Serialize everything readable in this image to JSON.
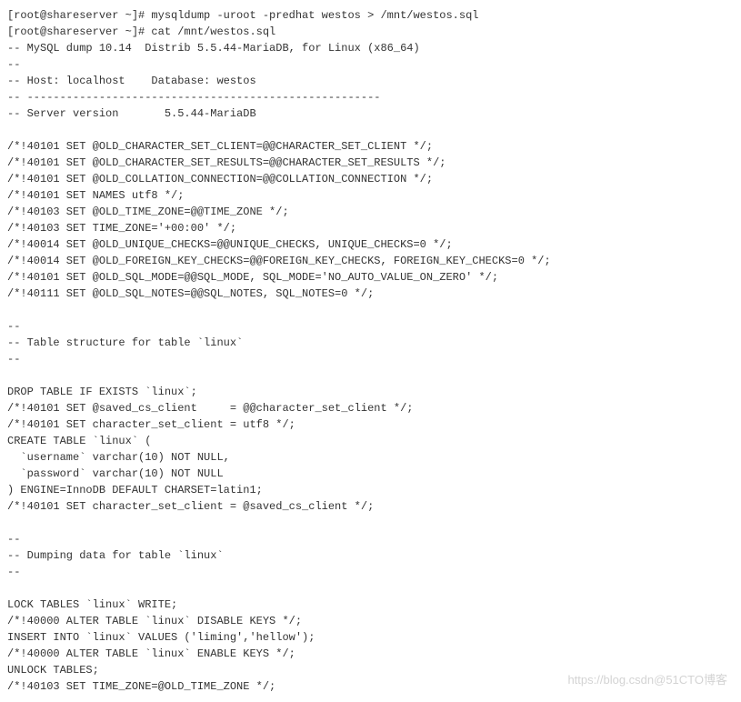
{
  "lines": [
    "[root@shareserver ~]# mysqldump -uroot -predhat westos > /mnt/westos.sql",
    "[root@shareserver ~]# cat /mnt/westos.sql",
    "-- MySQL dump 10.14  Distrib 5.5.44-MariaDB, for Linux (x86_64)",
    "--",
    "-- Host: localhost    Database: westos",
    "-- ------------------------------------------------------",
    "-- Server version       5.5.44-MariaDB",
    "",
    "/*!40101 SET @OLD_CHARACTER_SET_CLIENT=@@CHARACTER_SET_CLIENT */;",
    "/*!40101 SET @OLD_CHARACTER_SET_RESULTS=@@CHARACTER_SET_RESULTS */;",
    "/*!40101 SET @OLD_COLLATION_CONNECTION=@@COLLATION_CONNECTION */;",
    "/*!40101 SET NAMES utf8 */;",
    "/*!40103 SET @OLD_TIME_ZONE=@@TIME_ZONE */;",
    "/*!40103 SET TIME_ZONE='+00:00' */;",
    "/*!40014 SET @OLD_UNIQUE_CHECKS=@@UNIQUE_CHECKS, UNIQUE_CHECKS=0 */;",
    "/*!40014 SET @OLD_FOREIGN_KEY_CHECKS=@@FOREIGN_KEY_CHECKS, FOREIGN_KEY_CHECKS=0 */;",
    "/*!40101 SET @OLD_SQL_MODE=@@SQL_MODE, SQL_MODE='NO_AUTO_VALUE_ON_ZERO' */;",
    "/*!40111 SET @OLD_SQL_NOTES=@@SQL_NOTES, SQL_NOTES=0 */;",
    "",
    "--",
    "-- Table structure for table `linux`",
    "--",
    "",
    "DROP TABLE IF EXISTS `linux`;",
    "/*!40101 SET @saved_cs_client     = @@character_set_client */;",
    "/*!40101 SET character_set_client = utf8 */;",
    "CREATE TABLE `linux` (",
    "  `username` varchar(10) NOT NULL,",
    "  `password` varchar(10) NOT NULL",
    ") ENGINE=InnoDB DEFAULT CHARSET=latin1;",
    "/*!40101 SET character_set_client = @saved_cs_client */;",
    "",
    "--",
    "-- Dumping data for table `linux`",
    "--",
    "",
    "LOCK TABLES `linux` WRITE;",
    "/*!40000 ALTER TABLE `linux` DISABLE KEYS */;",
    "INSERT INTO `linux` VALUES ('liming','hellow');",
    "/*!40000 ALTER TABLE `linux` ENABLE KEYS */;",
    "UNLOCK TABLES;",
    "/*!40103 SET TIME_ZONE=@OLD_TIME_ZONE */;"
  ],
  "watermark": "https://blog.csdn@51CTO博客"
}
